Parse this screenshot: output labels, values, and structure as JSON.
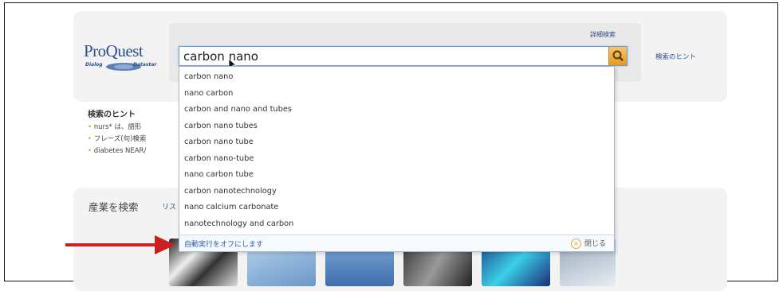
{
  "header": {
    "logo_text": "ProQuest",
    "logo_sub_left": "Dialog",
    "logo_sub_right": "Datastar",
    "advanced_search_link": "詳細検索",
    "search_hints_link": "検索のヒント"
  },
  "search": {
    "value": "carbon nano",
    "button_icon": "search-icon"
  },
  "suggestions": [
    "carbon nano",
    "nano carbon",
    "carbon and nano and tubes",
    "carbon nano tubes",
    "carbon nano tube",
    "carbon nano-tube",
    "nano carbon tube",
    "carbon nanotechnology",
    "nano calcium carbonate",
    "nanotechnology and carbon"
  ],
  "dropdown_footer": {
    "autocomplete_off": "自動実行をオフにします",
    "close_label": "閉じる"
  },
  "hints": {
    "title": "検索のヒント",
    "items": [
      "nurs* は、語形",
      "フレーズ(句)検索",
      "diabetes NEAR/"
    ]
  },
  "industry": {
    "title": "産業を検索",
    "list_link": "リス"
  },
  "colors": {
    "link": "#2d4e8a",
    "arrow": "#cc2020",
    "search_button": "#e79a1e"
  }
}
